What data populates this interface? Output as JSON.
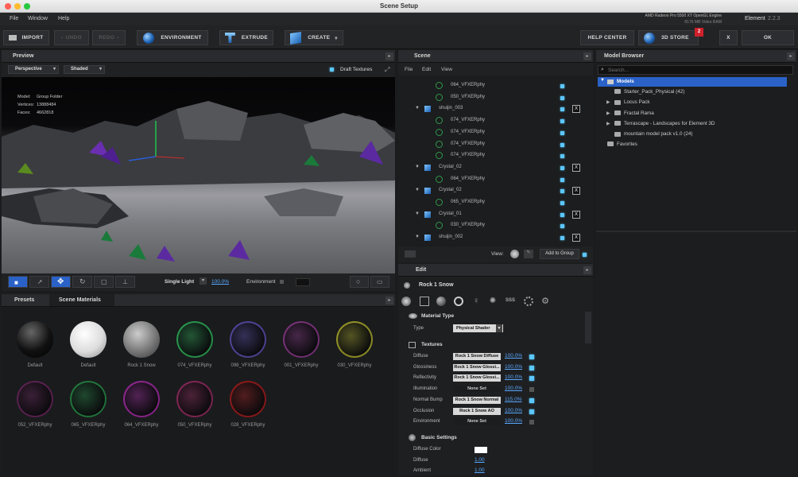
{
  "window": {
    "title": "Scene Setup"
  },
  "menubar": {
    "items": [
      "File",
      "Window",
      "Help"
    ],
    "gpu": "AMD Radeon Pro 5500 XT OpenGL Engine",
    "vram": "8176 MB Video RAM",
    "app_name": "Element",
    "app_version": "2.2.3"
  },
  "toolbar": {
    "import": "IMPORT",
    "undo": "UNDO",
    "redo": "REDO",
    "environment": "ENVIRONMENT",
    "extrude": "EXTRUDE",
    "create": "CREATE",
    "help_center": "HELP CENTER",
    "store": "3D STORE",
    "store_badge": "2",
    "close": "X",
    "ok": "OK"
  },
  "preview": {
    "title": "Preview",
    "camera": "Perspective",
    "shading": "Shaded",
    "draft": "Draft Textures",
    "info": [
      {
        "label": "Model:",
        "value": "Group Folder"
      },
      {
        "label": "Vertices:",
        "value": "13888484"
      },
      {
        "label": "Faces:",
        "value": "4662818"
      }
    ],
    "light": "Single Light",
    "light_pct": "100.0%",
    "environment": "Environment"
  },
  "scene": {
    "title": "Scene",
    "menu": [
      "File",
      "Edit",
      "View"
    ],
    "rows": [
      {
        "name": "064_VFXERphy",
        "type": "mat"
      },
      {
        "name": "050_VFXERphy",
        "type": "mat"
      },
      {
        "name": "shuijin_003",
        "type": "obj"
      },
      {
        "name": "074_VFXERphy",
        "type": "mat"
      },
      {
        "name": "074_VFXERphy",
        "type": "mat"
      },
      {
        "name": "074_VFXERphy",
        "type": "mat"
      },
      {
        "name": "074_VFXERphy",
        "type": "mat"
      },
      {
        "name": "Crystal_02",
        "type": "obj"
      },
      {
        "name": "064_VFXERphy",
        "type": "mat"
      },
      {
        "name": "Crystal_02",
        "type": "obj"
      },
      {
        "name": "065_VFXERphy",
        "type": "mat"
      },
      {
        "name": "Crystal_01",
        "type": "obj"
      },
      {
        "name": "030_VFXERphy",
        "type": "mat"
      },
      {
        "name": "shuijin_002",
        "type": "obj"
      }
    ],
    "view_label": "View:",
    "add_group": "Add to Group"
  },
  "model_browser": {
    "title": "Model Browser",
    "search_placeholder": "Search...",
    "root": "Models",
    "items": [
      "Starter_Pack_Physical (42)",
      "Locus Pack",
      "Fractal Rama",
      "Terrascape - Landscapes for Element 3D",
      "mountain model pack v1.0 (24)"
    ],
    "favorites": "Favorites"
  },
  "materials": {
    "tabs": [
      "Presets",
      "Scene Materials"
    ],
    "items": [
      {
        "name": "Default",
        "color": "#111111"
      },
      {
        "name": "Default",
        "color": "#eeeeee"
      },
      {
        "name": "Rock 1 Snow",
        "color": "#8a8a8a"
      },
      {
        "name": "074_VFXERphy",
        "color": "#33cc66"
      },
      {
        "name": "098_VFXERphy",
        "color": "#6a5acd"
      },
      {
        "name": "001_VFXERphy",
        "color": "#a040a0"
      },
      {
        "name": "030_VFXERphy",
        "color": "#c8c830"
      },
      {
        "name": "052_VFXERphy",
        "color": "#7a2a6a"
      },
      {
        "name": "065_VFXERphy",
        "color": "#2aa050"
      },
      {
        "name": "064_VFXERphy",
        "color": "#c030c0"
      },
      {
        "name": "050_VFXERphy",
        "color": "#b03070"
      },
      {
        "name": "028_VFXERphy",
        "color": "#c02020"
      }
    ]
  },
  "edit": {
    "title": "Edit",
    "material_name": "Rock 1 Snow",
    "material_type_title": "Material Type",
    "type_label": "Type",
    "type_value": "Physical Shader",
    "textures_title": "Textures",
    "textures": [
      {
        "label": "Diffuse",
        "slot": "Rock 1 Snow Diffuse",
        "pct": "100.0%",
        "on": true
      },
      {
        "label": "Glossiness",
        "slot": "Rock 1 Snow Glossi...",
        "pct": "100.0%",
        "on": true
      },
      {
        "label": "Reflectivity",
        "slot": "Rock 1 Snow Glossi...",
        "pct": "100.0%",
        "on": true
      },
      {
        "label": "Illumination",
        "slot": "None Set",
        "pct": "100.0%",
        "on": false
      },
      {
        "label": "Normal Bump",
        "slot": "Rock 1 Snow Normal",
        "pct": "115.0%",
        "on": true
      },
      {
        "label": "Occlusion",
        "slot": "Rock 1 Snow AO",
        "pct": "100.0%",
        "on": true
      },
      {
        "label": "Environment",
        "slot": "None Set",
        "pct": "100.0%",
        "on": false
      }
    ],
    "basic_title": "Basic Settings",
    "basic": [
      {
        "label": "Diffuse Color",
        "value": ""
      },
      {
        "label": "Diffuse",
        "value": "1.00"
      },
      {
        "label": "Ambient",
        "value": "1.00"
      }
    ]
  }
}
